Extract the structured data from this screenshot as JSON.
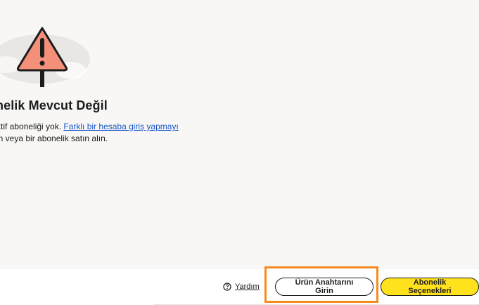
{
  "dialog": {
    "title": "nelik Mevcut Değil",
    "line1_prefix": "ktif aboneliği yok. ",
    "line1_link": "Farklı bir hesaba giriş yapmayı",
    "line2": "in veya bir abonelik satın alın."
  },
  "footer": {
    "help_label": "Yardım",
    "enter_key_label": "Ürün Anahtarını Girin",
    "subscription_options_label": "Abonelik Seçenekleri"
  },
  "colors": {
    "accent_yellow": "#ffe11c",
    "link_blue": "#1a56c7",
    "highlight_orange": "#f68b1f",
    "warning_fill": "#f4907a"
  },
  "icons": {
    "illustration": "warning-sign-icon",
    "help": "help-circle-icon"
  }
}
